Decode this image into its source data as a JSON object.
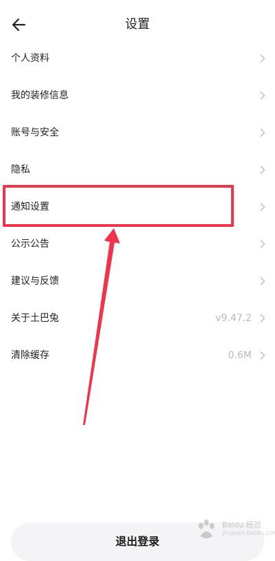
{
  "header": {
    "title": "设置",
    "back_icon": "arrow-left-icon"
  },
  "menu": {
    "items": [
      {
        "label": "个人资料",
        "value": ""
      },
      {
        "label": "我的装修信息",
        "value": ""
      },
      {
        "label": "账号与安全",
        "value": ""
      },
      {
        "label": "隐私",
        "value": ""
      },
      {
        "label": "通知设置",
        "value": ""
      },
      {
        "label": "公示公告",
        "value": ""
      },
      {
        "label": "建议与反馈",
        "value": ""
      },
      {
        "label": "关于土巴兔",
        "value": "v9.47.2"
      },
      {
        "label": "清除缓存",
        "value": "0.6M"
      }
    ],
    "chevron_icon": "chevron-right-icon"
  },
  "footer": {
    "logout_label": "退出登录"
  },
  "annotation": {
    "highlight_color": "#f0344b",
    "highlighted_item": "通知设置"
  },
  "watermark": {
    "brand": "Baidu",
    "text": "Baidu 经验",
    "sub": "jingyan.baidu.com"
  }
}
